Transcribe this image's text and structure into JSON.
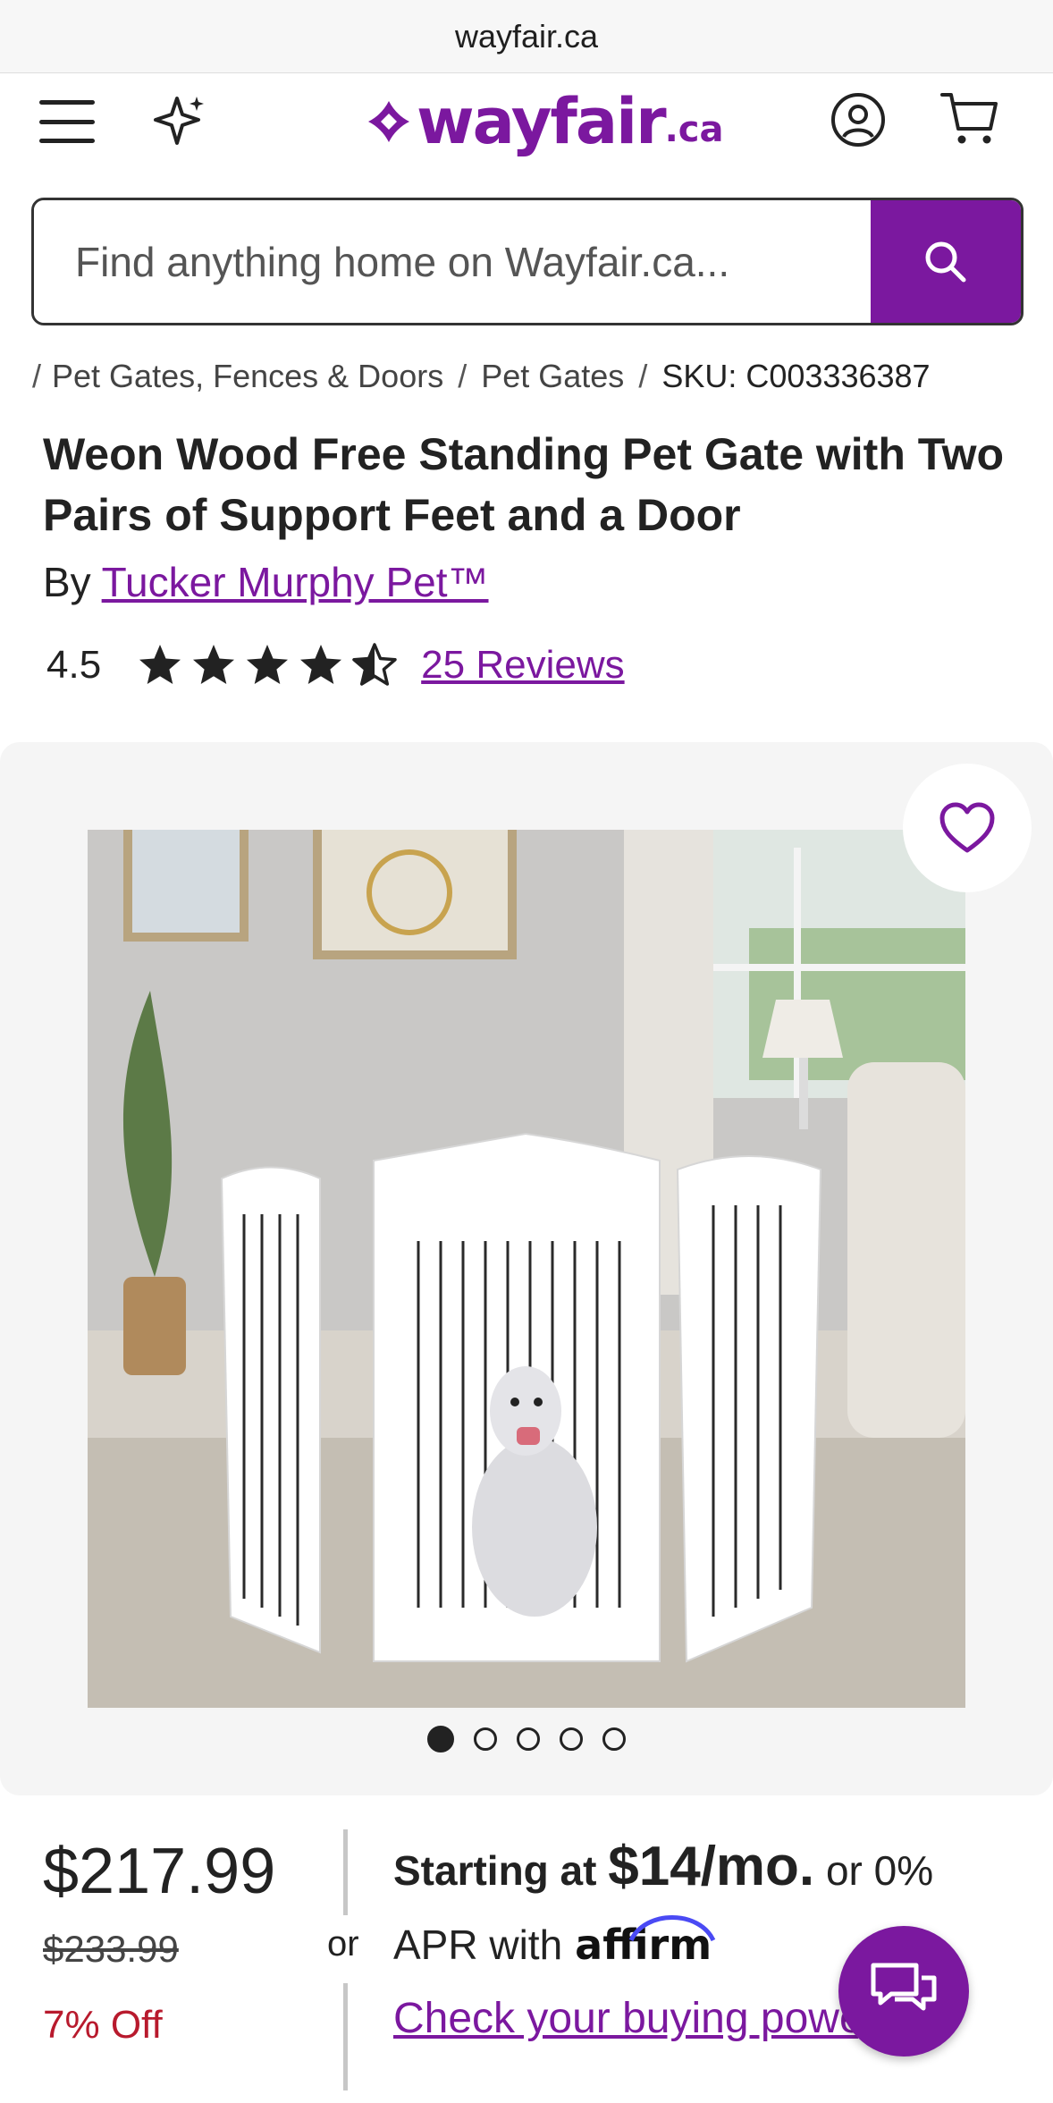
{
  "browser": {
    "url": "wayfair.ca"
  },
  "header": {
    "logo_word": "wayfair",
    "logo_tld": ".ca",
    "menu_icon": "hamburger-menu-icon",
    "sparkle_icon": "sparkle-icon",
    "account_icon": "account-icon",
    "cart_icon": "cart-icon"
  },
  "search": {
    "placeholder": "Find anything home on Wayfair.ca...",
    "button_icon": "search-icon"
  },
  "breadcrumb": {
    "items": [
      "Pet Gates, Fences & Doors",
      "Pet Gates",
      "SKU: C003336387"
    ],
    "separator": "/"
  },
  "product": {
    "title": "Weon Wood Free Standing Pet Gate with Two Pairs of Support Feet and a Door",
    "by_label": "By",
    "brand": "Tucker Murphy Pet™",
    "rating": "4.5",
    "rating_value": 4.5,
    "rating_max": 5,
    "reviews": "25 Reviews"
  },
  "gallery": {
    "image_count": 5,
    "active_index": 0,
    "favorite_icon": "heart-icon"
  },
  "pricing": {
    "price": "$217.99",
    "was_price": "$233.99",
    "discount": "7% Off",
    "or_label": "or",
    "starting_at": "Starting at",
    "monthly": "$14/mo.",
    "or_zero": "or 0%",
    "apr_with": "APR with",
    "affirm": "affirm",
    "check_power": "Check your buying power"
  },
  "chat": {
    "icon": "chat-icon"
  },
  "colors": {
    "brand": "#7b189f",
    "discount": "#b81a2d"
  }
}
